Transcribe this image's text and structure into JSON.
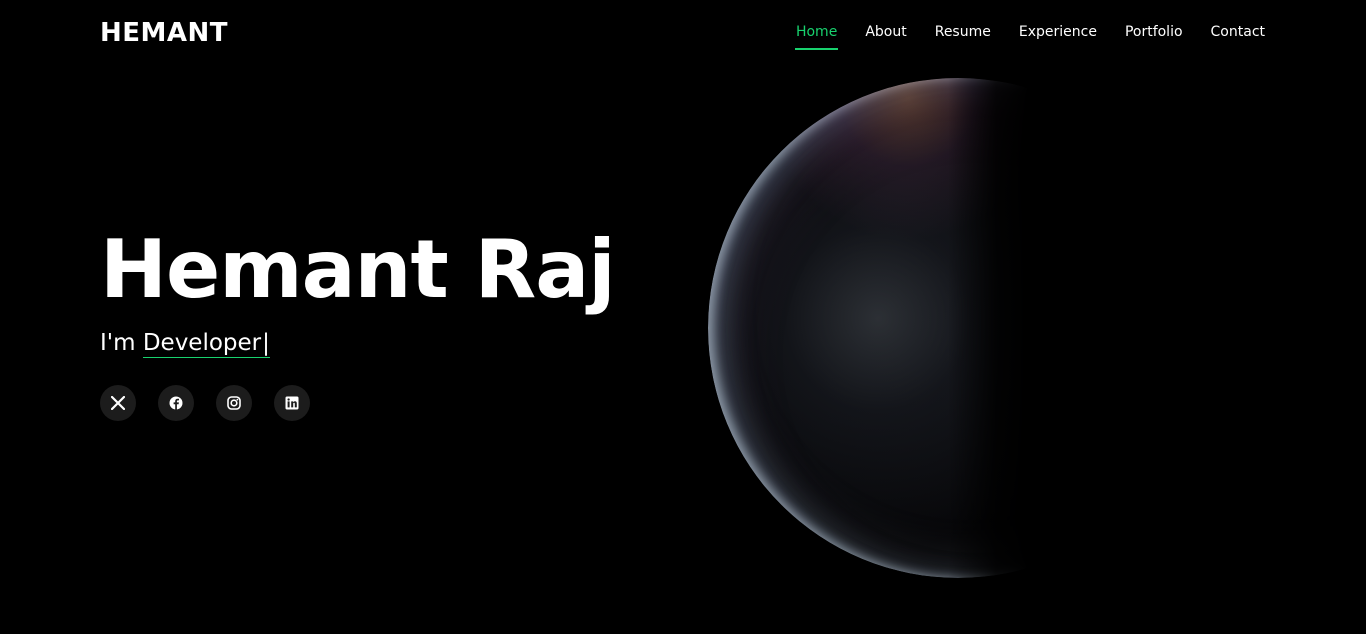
{
  "header": {
    "logo": "HEMANT",
    "nav": [
      {
        "label": "Home",
        "active": true
      },
      {
        "label": "About",
        "active": false
      },
      {
        "label": "Resume",
        "active": false
      },
      {
        "label": "Experience",
        "active": false
      },
      {
        "label": "Portfolio",
        "active": false
      },
      {
        "label": "Contact",
        "active": false
      }
    ],
    "accent_color": "#18d26e"
  },
  "hero": {
    "title": "Hemant Raj",
    "subtitle_prefix": "I'm",
    "typed_text": "Developer",
    "cursor": "|"
  },
  "socials": [
    {
      "name": "x-twitter-icon"
    },
    {
      "name": "facebook-icon"
    },
    {
      "name": "instagram-icon"
    },
    {
      "name": "linkedin-icon"
    }
  ],
  "background": {
    "color": "#000000",
    "decoration": "planet"
  }
}
